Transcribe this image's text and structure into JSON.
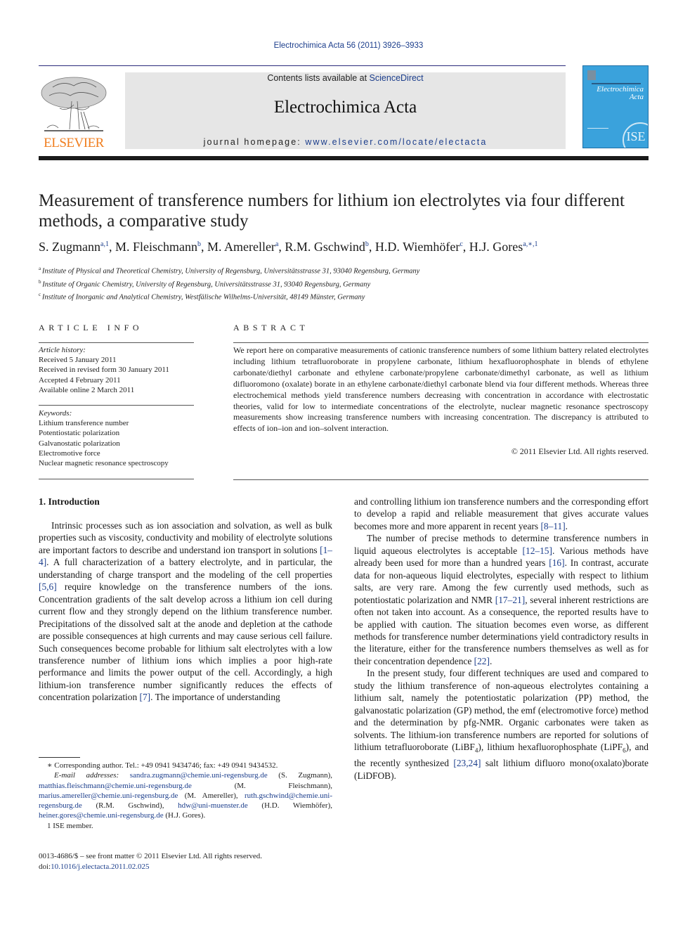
{
  "header": {
    "journal_reference": "Electrochimica Acta 56 (2011) 3926–3933",
    "contents_prefix": "Contents lists available at ",
    "contents_link": "ScienceDirect",
    "journal_title": "Electrochimica Acta",
    "homepage_prefix": "journal homepage: ",
    "homepage_link": "www.elsevier.com/locate/electacta",
    "publisher_logo_text": "ELSEVIER",
    "cover_title_line1": "Electrochimica",
    "cover_title_line2": "Acta",
    "cover_badge": "ISE",
    "colors": {
      "link": "#1c3e8c",
      "elsevier_orange": "#f07e1f",
      "cover_blue": "#3aa2dc",
      "header_gray": "#e6e6e6"
    }
  },
  "article": {
    "title": "Measurement of transference numbers for lithium ion electrolytes via four different methods, a comparative study",
    "authors": [
      {
        "name": "S. Zugmann",
        "sup": "a,1",
        "sep": ", "
      },
      {
        "name": "M. Fleischmann",
        "sup": "b",
        "sep": ", "
      },
      {
        "name": "M. Amereller",
        "sup": "a",
        "sep": ", "
      },
      {
        "name": "R.M. Gschwind",
        "sup": "b",
        "sep": ", "
      },
      {
        "name": "H.D. Wiemhöfer",
        "sup": "c",
        "sep": ", "
      },
      {
        "name": "H.J. Gores",
        "sup": "a,∗,1",
        "sep": ""
      }
    ],
    "affiliations": [
      {
        "key": "a",
        "text": "Institute of Physical and Theoretical Chemistry, University of Regensburg, Universitätsstrasse 31, 93040 Regensburg, Germany"
      },
      {
        "key": "b",
        "text": "Institute of Organic Chemistry, University of Regensburg, Universitätsstrasse 31, 93040 Regensburg, Germany"
      },
      {
        "key": "c",
        "text": "Institute of Inorganic and Analytical Chemistry, Westfälische Wilhelms-Universität, 48149 Münster, Germany"
      }
    ]
  },
  "article_info": {
    "heading": "ARTICLE INFO",
    "history_label": "Article history:",
    "history": [
      "Received 5 January 2011",
      "Received in revised form 30 January 2011",
      "Accepted 4 February 2011",
      "Available online 2 March 2011"
    ],
    "keywords_label": "Keywords:",
    "keywords": [
      "Lithium transference number",
      "Potentiostatic polarization",
      "Galvanostatic polarization",
      "Electromotive force",
      "Nuclear magnetic resonance spectroscopy"
    ]
  },
  "abstract": {
    "heading": "ABSTRACT",
    "text": "We report here on comparative measurements of cationic transference numbers of some lithium battery related electrolytes including lithium tetrafluoroborate in propylene carbonate, lithium hexafluorophosphate in blends of ethylene carbonate/diethyl carbonate and ethylene carbonate/propylene carbonate/dimethyl carbonate, as well as lithium difluoromono (oxalate) borate in an ethylene carbonate/diethyl carbonate blend via four different methods. Whereas three electrochemical methods yield transference numbers decreasing with concentration in accordance with electrostatic theories, valid for low to intermediate concentrations of the electrolyte, nuclear magnetic resonance spectroscopy measurements show increasing transference numbers with increasing concentration. The discrepancy is attributed to effects of ion–ion and ion–solvent interaction.",
    "copyright": "© 2011 Elsevier Ltd. All rights reserved."
  },
  "body": {
    "section_heading": "1.  Introduction",
    "p1": [
      {
        "t": "Intrinsic processes such as ion association and solvation, as well as bulk properties such as viscosity, conductivity and mobility of electrolyte solutions are important factors to describe and understand ion transport in solutions "
      },
      {
        "ref": "[1–4]"
      },
      {
        "t": ". A full characterization of a battery electrolyte, and in particular, the understanding of charge transport and the modeling of the cell properties "
      },
      {
        "ref": "[5,6]"
      },
      {
        "t": " require knowledge on the transference numbers of the ions. Concentration gradients of the salt develop across a lithium ion cell during current flow and they strongly depend on the lithium transference number. Precipitations of the dissolved salt at the anode and depletion at the cathode are possible consequences at high currents and may cause serious cell failure. Such consequences become probable for lithium salt electrolytes with a low transference number of lithium ions which implies a poor high-rate performance and limits the power output of the cell. Accordingly, a high lithium-ion transference number significantly reduces the effects of concentration polarization "
      },
      {
        "ref": "[7]"
      },
      {
        "t": ". The importance of understanding"
      }
    ],
    "p1_cont": [
      {
        "t": "and controlling lithium ion transference numbers and the corresponding effort to develop a rapid and reliable measurement that gives accurate values becomes more and more apparent in recent years "
      },
      {
        "ref": "[8–11]"
      },
      {
        "t": "."
      }
    ],
    "p2": [
      {
        "t": "The number of precise methods to determine transference numbers in liquid aqueous electrolytes is acceptable "
      },
      {
        "ref": "[12–15]"
      },
      {
        "t": ". Various methods have already been used for more than a hundred years "
      },
      {
        "ref": "[16]"
      },
      {
        "t": ". In contrast, accurate data for non-aqueous liquid electrolytes, especially with respect to lithium salts, are very rare. Among the few currently used methods, such as potentiostatic polarization and NMR "
      },
      {
        "ref": "[17–21]"
      },
      {
        "t": ", several inherent restrictions are often not taken into account. As a consequence, the reported results have to be applied with caution. The situation becomes even worse, as different methods for transference number determinations yield contradictory results in the literature, either for the transference numbers themselves as well as for their concentration dependence "
      },
      {
        "ref": "[22]"
      },
      {
        "t": "."
      }
    ],
    "p3": [
      {
        "t": "In the present study, four different techniques are used and compared to study the lithium transference of non-aqueous electrolytes containing a lithium salt, namely the potentiostatic polarization (PP) method, the galvanostatic polarization (GP) method, the emf (electromotive force) method and the determination by pfg-NMR. Organic carbonates were taken as solvents. The lithium-ion transference numbers are reported for solutions of lithium tetrafluoroborate (LiBF"
      },
      {
        "sub": "4"
      },
      {
        "t": "), lithium hexafluorophosphate (LiPF"
      },
      {
        "sub": "6"
      },
      {
        "t": "), and the recently synthesized "
      },
      {
        "ref": "[23,24]"
      },
      {
        "t": " salt lithium difluoro mono(oxalato)borate (LiDFOB)."
      }
    ]
  },
  "footnotes": {
    "corresponding": "∗  Corresponding author. Tel.: +49 0941 9434746; fax: +49 0941 9434532.",
    "email_label": "E-mail addresses: ",
    "emails": [
      {
        "email": "sandra.zugmann@chemie.uni-regensburg.de",
        "name": " (S. Zugmann), "
      },
      {
        "email": "matthias.fleischmann@chemie.uni-regensburg.de",
        "name": " (M. Fleischmann), "
      },
      {
        "email": "marius.amereller@chemie.uni-regensburg.de",
        "name": " (M. Amereller), "
      },
      {
        "email": "ruth.gschwind@chemie.uni-regensburg.de",
        "name": " (R.M. Gschwind), "
      },
      {
        "email": "hdw@uni-muenster.de",
        "name": " (H.D. Wiemhöfer), "
      },
      {
        "email": "heiner.gores@chemie.uni-regensburg.de",
        "name": " (H.J. Gores)."
      }
    ],
    "ise": "1  ISE member.",
    "issn": "0013-4686/$ – see front matter © 2011 Elsevier Ltd. All rights reserved.",
    "doi_label": "doi:",
    "doi": "10.1016/j.electacta.2011.02.025"
  }
}
